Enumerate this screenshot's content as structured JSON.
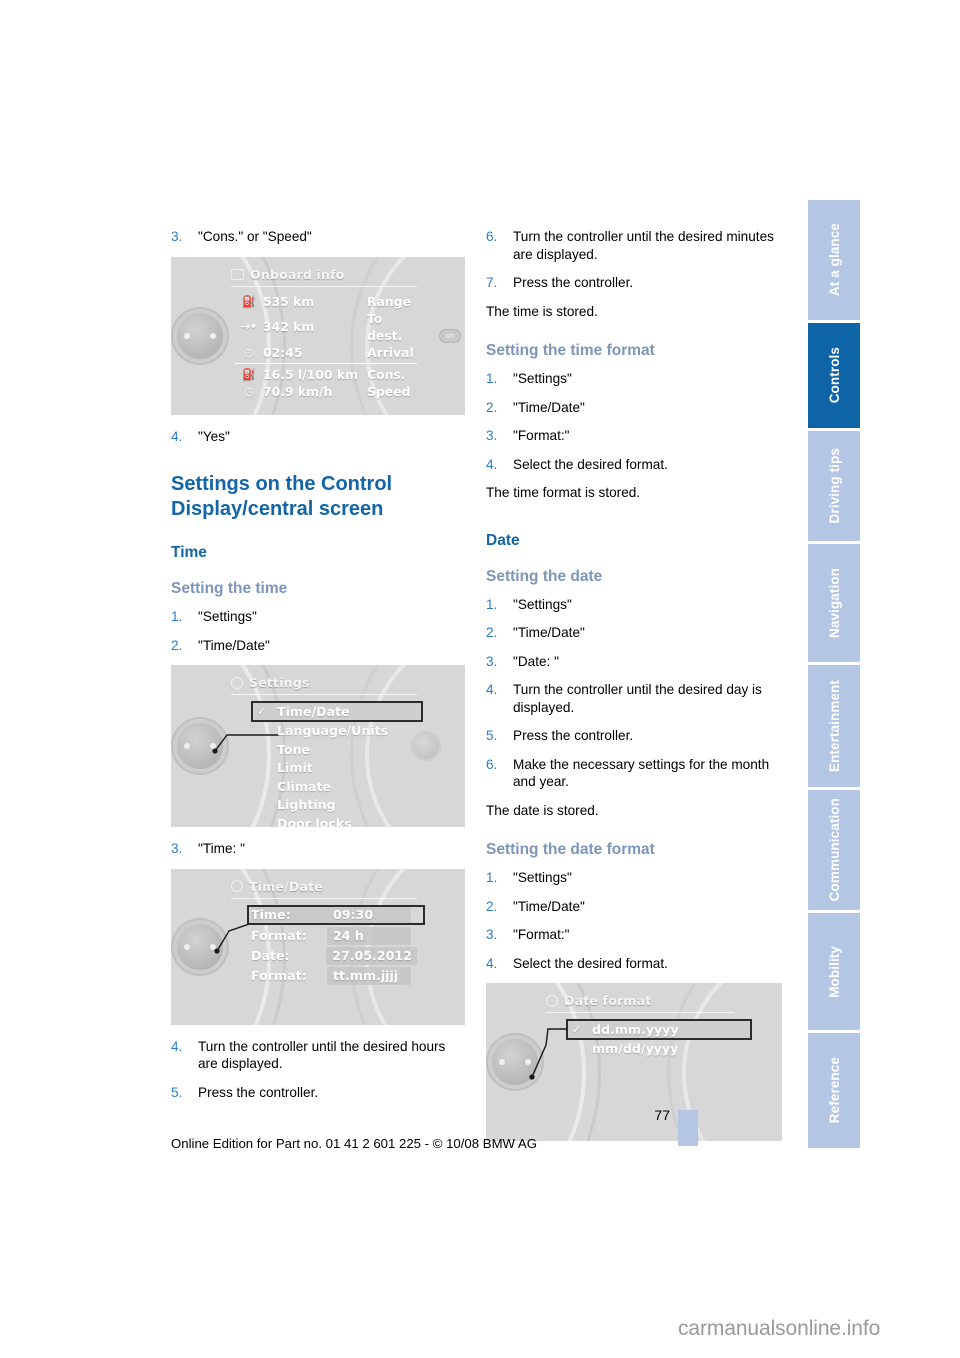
{
  "document": {
    "page_number": "77",
    "footer_note": "Online Edition for Part no. 01 41 2 601 225 - © 10/08 BMW AG",
    "watermark": "carmanualsonline.info"
  },
  "colors": {
    "heading_blue": "#1265a8",
    "subheading_blue": "#7d95b8",
    "step_number_blue": "#2b7cc4",
    "tab_inactive": "#b3c6e3",
    "tab_active": "#0d65a8"
  },
  "sidebar": {
    "tabs": [
      {
        "label": "At a glance",
        "active": false
      },
      {
        "label": "Controls",
        "active": true
      },
      {
        "label": "Driving tips",
        "active": false
      },
      {
        "label": "Navigation",
        "active": false
      },
      {
        "label": "Entertainment",
        "active": false
      },
      {
        "label": "Communication",
        "active": false
      },
      {
        "label": "Mobility",
        "active": false
      },
      {
        "label": "Reference",
        "active": false
      }
    ]
  },
  "left_column": {
    "step3": {
      "num": "3.",
      "text": "\"Cons.\" or \"Speed\""
    },
    "step4": {
      "num": "4.",
      "text": "\"Yes\""
    },
    "heading_main": "Settings on the Control Display/central screen",
    "heading_time": "Time",
    "heading_setting_time": "Setting the time",
    "time_steps": [
      {
        "num": "1.",
        "text": "\"Settings\""
      },
      {
        "num": "2.",
        "text": "\"Time/Date\""
      }
    ],
    "step3_time": {
      "num": "3.",
      "text": "\"Time: \""
    },
    "time_steps_after": [
      {
        "num": "4.",
        "text": "Turn the controller until the desired hours are displayed."
      },
      {
        "num": "5.",
        "text": "Press the controller."
      }
    ]
  },
  "right_column": {
    "steps_top": [
      {
        "num": "6.",
        "text": "Turn the controller until the desired minutes are displayed."
      },
      {
        "num": "7.",
        "text": "Press the controller."
      }
    ],
    "note_time_stored": "The time is stored.",
    "heading_time_format": "Setting the time format",
    "time_format_steps": [
      {
        "num": "1.",
        "text": "\"Settings\""
      },
      {
        "num": "2.",
        "text": "\"Time/Date\""
      },
      {
        "num": "3.",
        "text": "\"Format:\""
      },
      {
        "num": "4.",
        "text": "Select the desired format."
      }
    ],
    "note_time_format_stored": "The time format is stored.",
    "heading_date": "Date",
    "heading_setting_date": "Setting the date",
    "date_steps": [
      {
        "num": "1.",
        "text": "\"Settings\""
      },
      {
        "num": "2.",
        "text": "\"Time/Date\""
      },
      {
        "num": "3.",
        "text": "\"Date: \""
      },
      {
        "num": "4.",
        "text": "Turn the controller until the desired day is displayed."
      },
      {
        "num": "5.",
        "text": "Press the controller."
      },
      {
        "num": "6.",
        "text": "Make the necessary settings for the month and year."
      }
    ],
    "note_date_stored": "The date is stored.",
    "heading_date_format": "Setting the date format",
    "date_format_steps": [
      {
        "num": "1.",
        "text": "\"Settings\""
      },
      {
        "num": "2.",
        "text": "\"Time/Date\""
      },
      {
        "num": "3.",
        "text": "\"Format:\""
      },
      {
        "num": "4.",
        "text": "Select the desired format."
      }
    ]
  },
  "figures": {
    "onboard_info": {
      "title": "Onboard info",
      "rows": [
        {
          "icon": "fuel-pump-icon",
          "glyph": "⛽",
          "value": "535 km",
          "label": "Range"
        },
        {
          "icon": "destination-arrow-icon",
          "glyph": "→•",
          "value": "342 km",
          "label": "To dest."
        },
        {
          "icon": "arrival-clock-icon",
          "glyph": "◴",
          "value": "02:45",
          "label": "Arrival"
        },
        {
          "icon": "consumption-icon",
          "glyph": "⛽",
          "value": "16.5 l/100 km",
          "label": "Cons."
        },
        {
          "icon": "speed-gauge-icon",
          "glyph": "◷",
          "value": "70.9 km/h",
          "label": "Speed"
        }
      ],
      "separator_after_row": 3,
      "right_button_label": "on"
    },
    "settings_menu": {
      "title": "Settings",
      "items": [
        {
          "label": "Time/Date",
          "selected": true,
          "checked": true
        },
        {
          "label": "Language/Units",
          "selected": false,
          "checked": false
        },
        {
          "label": "Tone",
          "selected": false,
          "checked": false
        },
        {
          "label": "Limit",
          "selected": false,
          "checked": false
        },
        {
          "label": "Climate",
          "selected": false,
          "checked": false
        },
        {
          "label": "Lighting",
          "selected": false,
          "checked": false
        },
        {
          "label": "Door locks",
          "selected": false,
          "checked": false
        }
      ]
    },
    "time_date_menu": {
      "title": "Time/Date",
      "rows": [
        {
          "key": "Time:",
          "value": "09:30",
          "selected": true
        },
        {
          "key": "Format:",
          "value": "24 h",
          "selected": false
        },
        {
          "key": "Date:",
          "value": "27.05.2012",
          "selected": false
        },
        {
          "key": "Format:",
          "value": "tt.mm.jjjj",
          "selected": false
        }
      ]
    },
    "date_format_menu": {
      "title": "Date format",
      "items": [
        {
          "label": "dd.mm.yyyy",
          "selected": true,
          "checked": true
        },
        {
          "label": "mm/dd/yyyy",
          "selected": false,
          "checked": false
        }
      ]
    }
  }
}
